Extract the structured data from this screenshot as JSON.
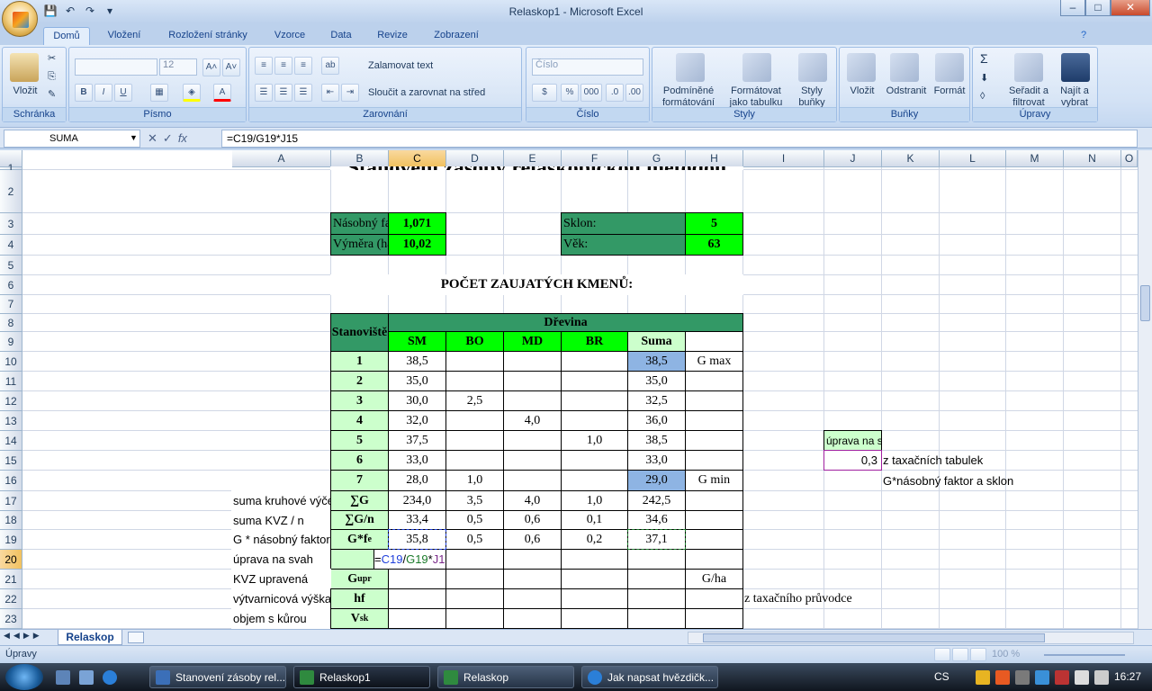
{
  "window": {
    "title": "Relaskop1 - Microsoft Excel",
    "controls": [
      "–",
      "□",
      "✕"
    ]
  },
  "qat": {
    "save": "💾",
    "undo": "↶",
    "redo": "↷",
    "more": "▾"
  },
  "tabs": [
    "Domů",
    "Vložení",
    "Rozložení stránky",
    "Vzorce",
    "Data",
    "Revize",
    "Zobrazení"
  ],
  "ribbon": {
    "schranka": {
      "label": "Schránka",
      "paste": "Vložit"
    },
    "pismo": {
      "label": "Písmo",
      "size": "12",
      "bold": "B",
      "italic": "I",
      "underline": "U"
    },
    "zarovnani": {
      "label": "Zarovnání",
      "wrap": "Zalamovat text",
      "merge": "Sloučit a zarovnat na střed"
    },
    "cislo": {
      "label": "Číslo",
      "format": "Číslo",
      "percent": "%",
      "thousands": "000"
    },
    "styly": {
      "label": "Styly",
      "cond": "Podmíněné formátování",
      "table": "Formátovat jako tabulku",
      "cellstyles": "Styly buňky"
    },
    "bunky": {
      "label": "Buňky",
      "insert": "Vložit",
      "delete": "Odstranit",
      "format": "Formát"
    },
    "upravy": {
      "label": "Úpravy",
      "sort": "Seřadit a filtrovat",
      "find": "Najít a vybrat"
    }
  },
  "formula_bar": {
    "name": "SUMA",
    "formula": "=C19/G19*J15"
  },
  "columns": [
    "A",
    "B",
    "C",
    "D",
    "E",
    "F",
    "G",
    "H",
    "I",
    "J",
    "K",
    "L",
    "M",
    "N",
    "O"
  ],
  "rows": [
    "1",
    "2",
    "3",
    "4",
    "5",
    "6",
    "7",
    "8",
    "9",
    "10",
    "11",
    "12",
    "13",
    "14",
    "15",
    "16",
    "17",
    "18",
    "19",
    "20",
    "21",
    "22",
    "23"
  ],
  "sheet": {
    "title": "Stanovení zásoby relaskopickou metodou",
    "nasobny_faktor_label": "Násobný faktor:",
    "nasobny_faktor": "1,071",
    "vymera_label": "Výměra (ha):",
    "vymera": "10,02",
    "sklon_label": "Sklon:",
    "sklon": "5",
    "vek_label": "Věk:",
    "vek": "63",
    "pocet": "POČET ZAUJATÝCH KMENŮ:",
    "stanoviste": "Stanoviště",
    "drevina": "Dřevina",
    "species": [
      "SM",
      "BO",
      "MD",
      "BR",
      "Suma"
    ],
    "table_rows": [
      {
        "id": "1",
        "SM": "38,5",
        "BO": "",
        "MD": "",
        "BR": "",
        "Suma": "38,5",
        "note": "G max"
      },
      {
        "id": "2",
        "SM": "35,0",
        "BO": "",
        "MD": "",
        "BR": "",
        "Suma": "35,0",
        "note": ""
      },
      {
        "id": "3",
        "SM": "30,0",
        "BO": "2,5",
        "MD": "",
        "BR": "",
        "Suma": "32,5",
        "note": ""
      },
      {
        "id": "4",
        "SM": "32,0",
        "BO": "",
        "MD": "4,0",
        "BR": "",
        "Suma": "36,0",
        "note": ""
      },
      {
        "id": "5",
        "SM": "37,5",
        "BO": "",
        "MD": "",
        "BR": "1,0",
        "Suma": "38,5",
        "note": ""
      },
      {
        "id": "6",
        "SM": "33,0",
        "BO": "",
        "MD": "",
        "BR": "",
        "Suma": "33,0",
        "note": ""
      },
      {
        "id": "7",
        "SM": "28,0",
        "BO": "1,0",
        "MD": "",
        "BR": "",
        "Suma": "29,0",
        "note": "G min"
      }
    ],
    "sum_rows": [
      {
        "label": "suma kruhové výčetní základny",
        "sym": "∑G",
        "SM": "234,0",
        "BO": "3,5",
        "MD": "4,0",
        "BR": "1,0",
        "Suma": "242,5"
      },
      {
        "label": "suma KVZ / n",
        "sym": "∑G/n",
        "SM": "33,4",
        "BO": "0,5",
        "MD": "0,6",
        "BR": "0,1",
        "Suma": "34,6"
      },
      {
        "label": "G * násobný faktor",
        "sym": "G*f",
        "sym_sub": "e",
        "SM": "35,8",
        "BO": "0,5",
        "MD": "0,6",
        "BR": "0,2",
        "Suma": "37,1"
      }
    ],
    "r20_label": "úprava na svah",
    "r20_formula": {
      "eq": "=",
      "c19": "C19",
      "slash": "/",
      "g19": "G19",
      "star": "*",
      "j15": "J15"
    },
    "r20_sym": "ᵻ",
    "r21_label": "KVZ upravená",
    "r21_sym": "G",
    "r21_sub": "upr",
    "r21_note": "G/ha",
    "r22_label": "výtvarnicová výška",
    "r22_sym": "hf",
    "r22_note": "z taxačního průvodce",
    "r23_label": "objem s kůrou",
    "r23_sym": "V",
    "r23_sub": "sk",
    "j14": "úprava na svah",
    "j15": "0,3",
    "k15": "z taxačních tabulek",
    "k16": "G*násobný faktor a sklon"
  },
  "sheet_tabs": {
    "active": "Relaskop"
  },
  "status": {
    "mode": "Úpravy",
    "zoom": "100 %"
  },
  "taskbar": {
    "items": [
      "Stanovení zásoby rel...",
      "Relaskop1",
      "Relaskop",
      "Jak napsat hvězdičk..."
    ],
    "lang": "CS",
    "time": "16:27"
  },
  "colors": {
    "dark_green": "#339966",
    "bright_green": "#00ff00",
    "pale_green": "#ccffcc",
    "blue": "#8eb4e3"
  }
}
